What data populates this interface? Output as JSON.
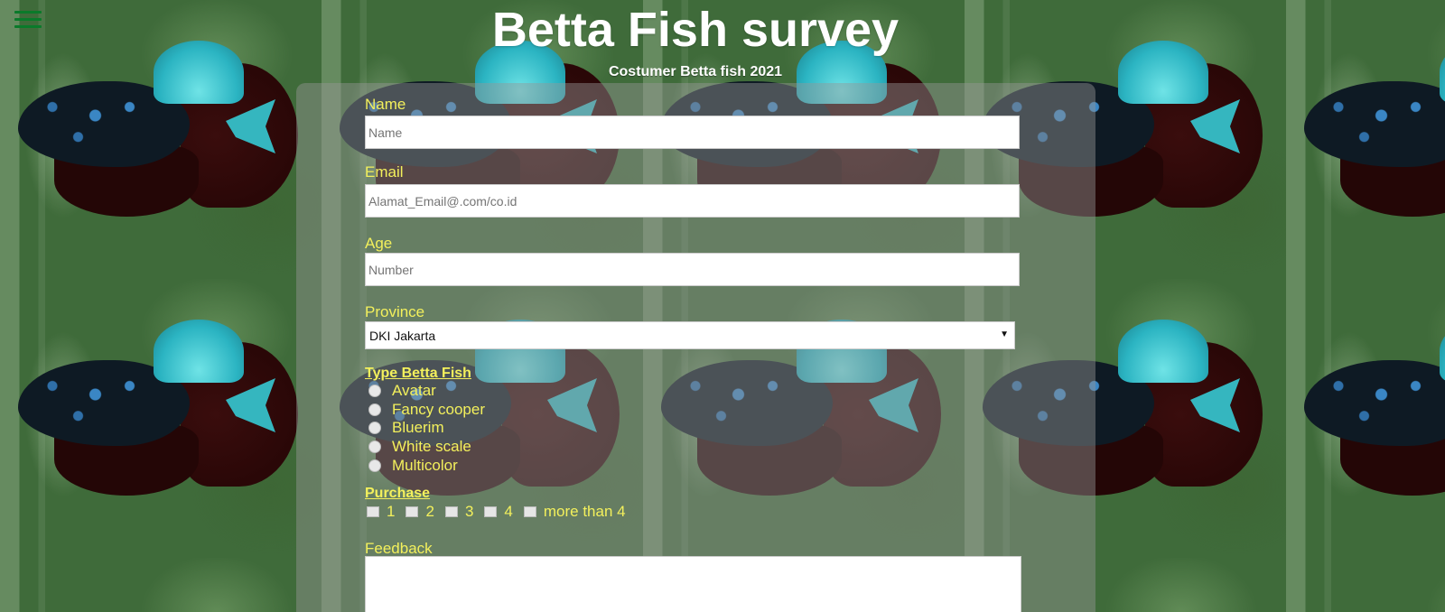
{
  "header": {
    "title": "Betta Fish survey",
    "subtitle": "Costumer Betta fish 2021"
  },
  "menu": {
    "icon": "hamburger-menu-icon"
  },
  "form": {
    "name": {
      "label": "Name",
      "placeholder": "Name"
    },
    "email": {
      "label": "Email",
      "placeholder": "Alamat_Email@.com/co.id"
    },
    "age": {
      "label": "Age",
      "placeholder": "Number"
    },
    "province": {
      "label": "Province",
      "selected": "DKI Jakarta"
    },
    "type": {
      "label": "Type Betta Fish",
      "options": [
        "Avatar",
        "Fancy cooper",
        "Bluerim",
        "White scale",
        "Multicolor"
      ]
    },
    "purchase": {
      "label": "Purchase",
      "options": [
        "1",
        "2",
        "3",
        "4",
        "more than 4"
      ]
    },
    "feedback": {
      "label": "Feedback"
    }
  },
  "colors": {
    "label": "#f3f05c",
    "menu": "#0a7a2a",
    "panel": "rgba(150,150,150,0.45)"
  }
}
